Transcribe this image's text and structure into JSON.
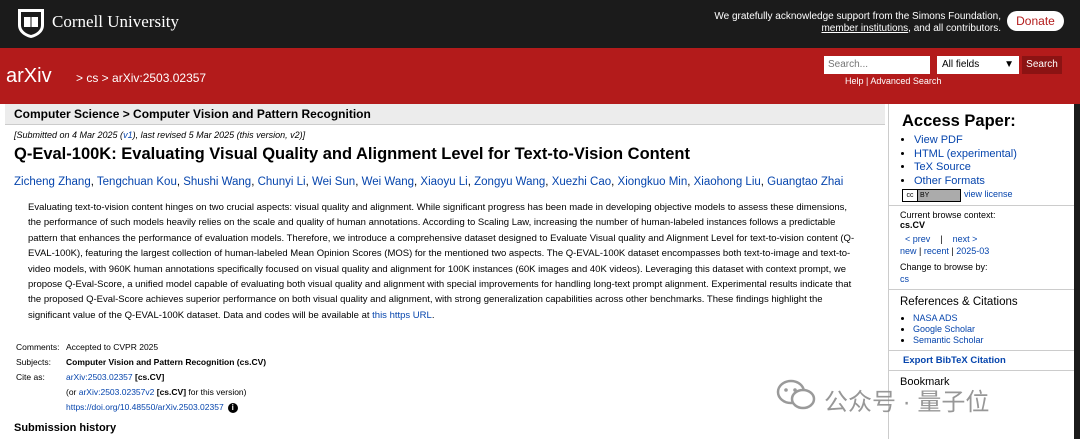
{
  "top": {
    "cornell": "Cornell University",
    "support_pre": "We gratefully acknowledge support from the Simons Foundation, ",
    "support_link": "member institutions",
    "support_post": ", and all contributors.",
    "donate": "Donate"
  },
  "banner": {
    "logo": "arXiv",
    "crumb_sep1": " > ",
    "crumb_cs": "cs",
    "crumb_sep2": " > ",
    "crumb_id": "arXiv:2503.02357",
    "search_placeholder": "Search...",
    "field": "All fields",
    "search_button": "Search",
    "help": "Help",
    "link_sep": " | ",
    "advanced": "Advanced Search"
  },
  "paper": {
    "category": "Computer Science > Computer Vision and Pattern Recognition",
    "dateline_pre": "[Submitted on 4 Mar 2025 (",
    "dateline_v1": "v1",
    "dateline_post": "), last revised 5 Mar 2025 (this version, v2)]",
    "title": "Q-Eval-100K: Evaluating Visual Quality and Alignment Level for Text-to-Vision Content",
    "authors": [
      "Zicheng Zhang",
      "Tengchuan Kou",
      "Shushi Wang",
      "Chunyi Li",
      "Wei Sun",
      "Wei Wang",
      "Xiaoyu Li",
      "Zongyu Wang",
      "Xuezhi Cao",
      "Xiongkuo Min",
      "Xiaohong Liu",
      "Guangtao Zhai"
    ],
    "abstract": "Evaluating text-to-vision content hinges on two crucial aspects: visual quality and alignment. While significant progress has been made in developing objective models to assess these dimensions, the performance of such models heavily relies on the scale and quality of human annotations. According to Scaling Law, increasing the number of human-labeled instances follows a predictable pattern that enhances the performance of evaluation models. Therefore, we introduce a comprehensive dataset designed to Evaluate Visual quality and Alignment Level for text-to-vision content (Q-EVAL-100K), featuring the largest collection of human-labeled Mean Opinion Scores (MOS) for the mentioned two aspects. The Q-EVAL-100K dataset encompasses both text-to-image and text-to-video models, with 960K human annotations specifically focused on visual quality and alignment for 100K instances (60K images and 40K videos). Leveraging this dataset with context prompt, we propose Q-Eval-Score, a unified model capable of evaluating both visual quality and alignment with special improvements for handling long-text prompt alignment. Experimental results indicate that the proposed Q-Eval-Score achieves superior performance on both visual quality and alignment, with strong generalization capabilities across other benchmarks. These findings highlight the significant value of the Q-EVAL-100K dataset. Data and codes will be available at ",
    "abstract_link": "this https URL",
    "abstract_end": ".",
    "comments_label": "Comments:",
    "comments": "Accepted to CVPR 2025",
    "subjects_label": "Subjects:",
    "subjects": "Computer Vision and Pattern Recognition (cs.CV)",
    "cite_label": "Cite as:",
    "cite_id": "arXiv:2503.02357",
    "cite_tag": " [cs.CV]",
    "cite2_pre": "(or ",
    "cite2_id": "arXiv:2503.02357v2",
    "cite2_tag": " [cs.CV]",
    "cite2_post": " for this version)",
    "doi": "https://doi.org/10.48550/arXiv.2503.02357",
    "submission_history": "Submission history"
  },
  "sidebar": {
    "access_title": "Access Paper:",
    "access_links": [
      "View PDF",
      "HTML (experimental)",
      "TeX Source",
      "Other Formats"
    ],
    "license_link": "view license",
    "browse_context_label": "Current browse context:",
    "browse_context": "cs.CV",
    "prev": "< prev",
    "nav_sep": "|",
    "next": "next >",
    "new": "new",
    "pipe": " | ",
    "recent": "recent",
    "month": "2025-03",
    "change_label": "Change to browse by:",
    "change_cs": "cs",
    "refs_title": "References & Citations",
    "refs": [
      "NASA ADS",
      "Google Scholar",
      "Semantic Scholar"
    ],
    "bibtex": "Export BibTeX Citation",
    "bookmark": "Bookmark"
  },
  "watermark": {
    "text": "公众号 · 量子位"
  },
  "colors": {
    "arxiv_red": "#b31b1b",
    "link": "#0645ad",
    "topbar": "#1b1b1b"
  }
}
